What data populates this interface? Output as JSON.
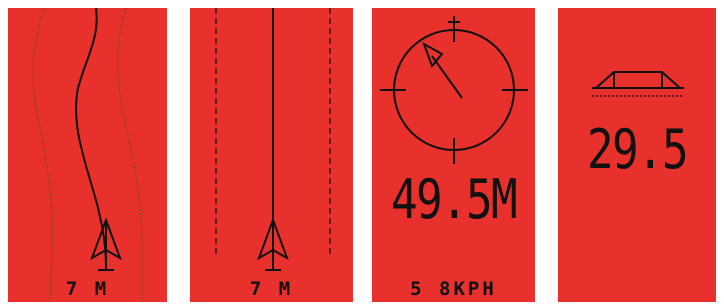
{
  "panels": {
    "track_deviation": {
      "distance_label": "7 M"
    },
    "heading_straight": {
      "distance_label": "7 M"
    },
    "compass": {
      "distance_readout": "49.5M",
      "speed_label": "5 8KPH"
    },
    "grade": {
      "value": "29.5"
    }
  },
  "colors": {
    "panel_background": "#e8302c",
    "ink": "#111111",
    "guide_line": "#7a4a20",
    "screen_background": "#ffffff"
  }
}
